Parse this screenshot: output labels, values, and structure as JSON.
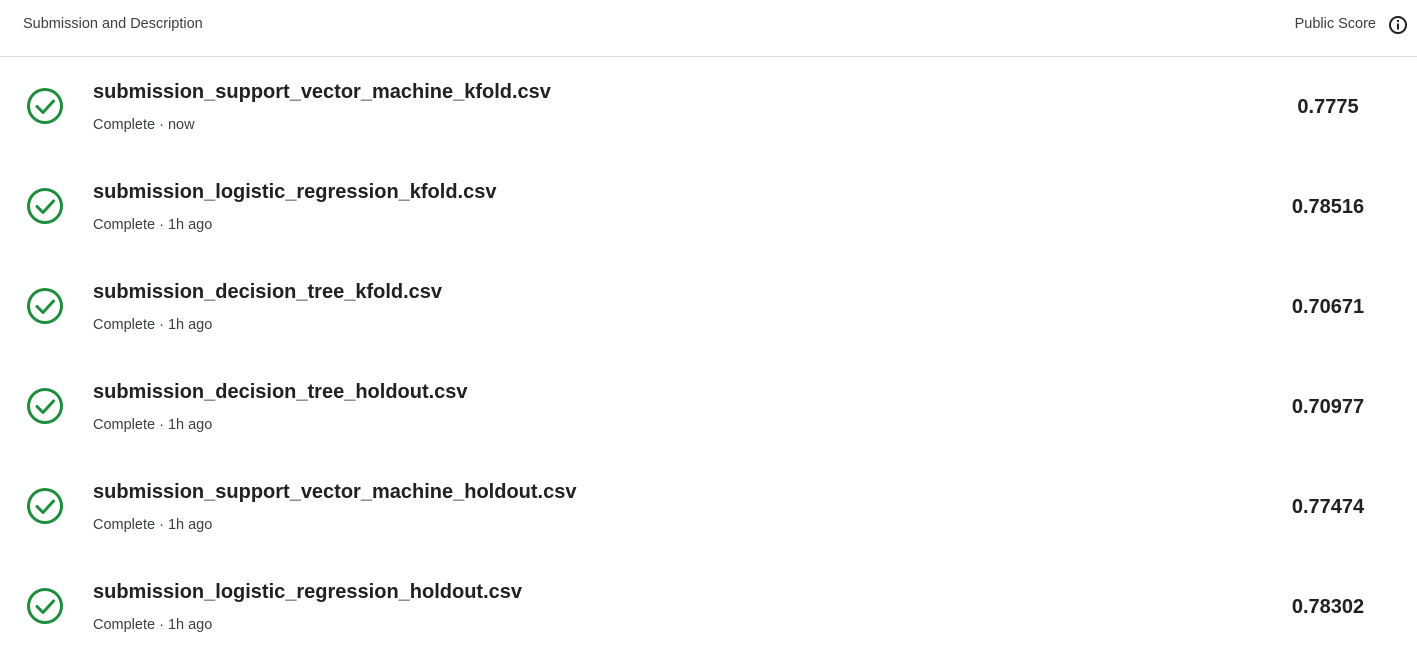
{
  "header": {
    "left_label": "Submission and Description",
    "right_label": "Public Score"
  },
  "colors": {
    "check": "#1e8e3e",
    "divider": "#dadce0"
  },
  "submissions": [
    {
      "file": "submission_support_vector_machine_kfold.csv",
      "status": "Complete · now",
      "score": "0.7775"
    },
    {
      "file": "submission_logistic_regression_kfold.csv",
      "status": "Complete · 1h ago",
      "score": "0.78516"
    },
    {
      "file": "submission_decision_tree_kfold.csv",
      "status": "Complete · 1h ago",
      "score": "0.70671"
    },
    {
      "file": "submission_decision_tree_holdout.csv",
      "status": "Complete · 1h ago",
      "score": "0.70977"
    },
    {
      "file": "submission_support_vector_machine_holdout.csv",
      "status": "Complete · 1h ago",
      "score": "0.77474"
    },
    {
      "file": "submission_logistic_regression_holdout.csv",
      "status": "Complete · 1h ago",
      "score": "0.78302"
    }
  ]
}
